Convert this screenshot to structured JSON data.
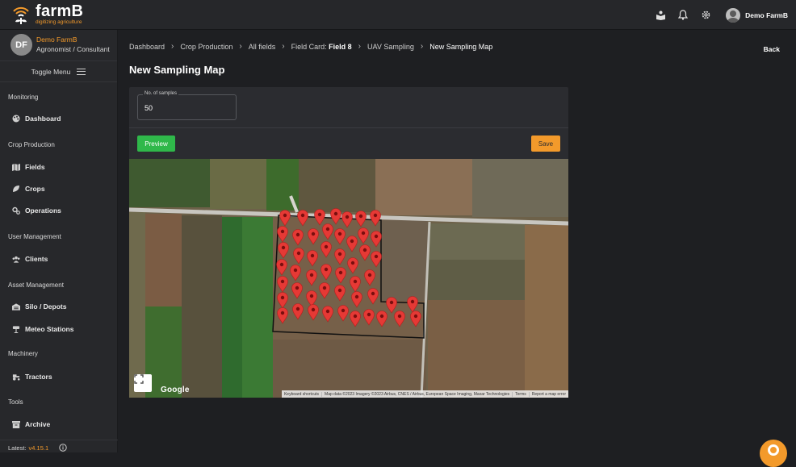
{
  "app": {
    "brand": "farmB",
    "tagline": "digitizing agriculture",
    "user_name": "Demo FarmB"
  },
  "profile": {
    "initials": "DF",
    "name": "Demo FarmB",
    "role": "Agronomist / Consultant"
  },
  "sidebar": {
    "toggle_label": "Toggle Menu",
    "sections": [
      {
        "title": "Monitoring",
        "items": [
          {
            "label": "Dashboard",
            "icon": "palette-icon"
          }
        ]
      },
      {
        "title": "Crop Production",
        "items": [
          {
            "label": "Fields",
            "icon": "map-icon"
          },
          {
            "label": "Crops",
            "icon": "leaf-icon"
          },
          {
            "label": "Operations",
            "icon": "gears-icon"
          }
        ]
      },
      {
        "title": "User Management",
        "items": [
          {
            "label": "Clients",
            "icon": "users-icon"
          }
        ]
      },
      {
        "title": "Asset Management",
        "items": [
          {
            "label": "Silo / Depots",
            "icon": "warehouse-icon"
          },
          {
            "label": "Meteo Stations",
            "icon": "tower-icon"
          }
        ]
      },
      {
        "title": "Machinery",
        "items": [
          {
            "label": "Tractors",
            "icon": "tractor-icon"
          }
        ]
      },
      {
        "title": "Tools",
        "items": [
          {
            "label": "Archive",
            "icon": "archive-icon"
          }
        ]
      }
    ],
    "footer_label": "Latest:",
    "footer_version": "v4.15.1"
  },
  "breadcrumb": {
    "items": [
      "Dashboard",
      "Crop Production",
      "All fields"
    ],
    "field_card_prefix": "Field Card:",
    "field_card_name": "Field 8",
    "uav": "UAV Sampling",
    "current": "New Sampling Map"
  },
  "page": {
    "title": "New Sampling Map",
    "back_label": "Back"
  },
  "form": {
    "samples_label": "No. of samples",
    "samples_value": "50",
    "preview_label": "Preview",
    "save_label": "Save"
  },
  "map": {
    "google_label": "Google",
    "attribution": [
      "Keyboard shortcuts",
      "Map data ©2023 Imagery ©2023 Airbus, CNES / Airbus, European Space Imaging, Maxar Technologies",
      "Terms",
      "Report a map error"
    ]
  },
  "colors": {
    "accent": "#f39a2b",
    "preview_green": "#2fb84a",
    "pin_red": "#e53935"
  }
}
